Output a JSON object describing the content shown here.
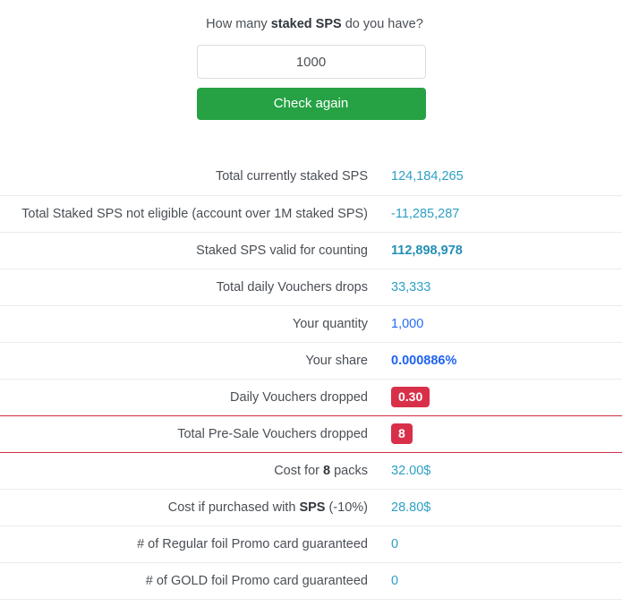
{
  "form": {
    "question_prefix": "How many ",
    "question_bold": "staked SPS",
    "question_suffix": " do you have?",
    "input_value": "1000",
    "input_placeholder": "",
    "button_label": "Check again",
    "button_color": "#26a244"
  },
  "colors": {
    "value_teal": "#2e9fc4",
    "value_blue": "#2a6cf4",
    "badge_red": "#d9304a",
    "highlight_border": "#cf2e43",
    "row_divider": "#e9ecef",
    "label_text": "#4a4f55"
  },
  "results": {
    "rows": [
      {
        "label": "Total currently staked SPS",
        "label_bold": "",
        "label_suffix": "",
        "value": "124,184,265",
        "style": "teal",
        "highlight": false
      },
      {
        "label": "Total Staked SPS not eligible (account over 1M staked SPS)",
        "label_bold": "",
        "label_suffix": "",
        "value": "-11,285,287",
        "style": "teal",
        "highlight": false
      },
      {
        "label": "Staked SPS valid for counting",
        "label_bold": "",
        "label_suffix": "",
        "value": "112,898,978",
        "style": "teal-bold",
        "highlight": false
      },
      {
        "label": "Total daily Vouchers drops",
        "label_bold": "",
        "label_suffix": "",
        "value": "33,333",
        "style": "teal",
        "highlight": false
      },
      {
        "label": "Your quantity",
        "label_bold": "",
        "label_suffix": "",
        "value": "1,000",
        "style": "blue",
        "highlight": false
      },
      {
        "label": "Your share",
        "label_bold": "",
        "label_suffix": "",
        "value": "0.000886%",
        "style": "blue-bold",
        "highlight": false
      },
      {
        "label": "Daily Vouchers dropped",
        "label_bold": "",
        "label_suffix": "",
        "value": "0.30",
        "style": "badge",
        "highlight": true
      },
      {
        "label": "Total Pre-Sale Vouchers dropped",
        "label_bold": "",
        "label_suffix": "",
        "value": "8",
        "style": "badge",
        "highlight": true
      },
      {
        "label": "Cost for ",
        "label_bold": "8",
        "label_suffix": " packs",
        "value": "32.00$",
        "style": "teal",
        "highlight": false
      },
      {
        "label": "Cost if purchased with ",
        "label_bold": "SPS",
        "label_suffix": " (-10%)",
        "value": "28.80$",
        "style": "teal",
        "highlight": false
      },
      {
        "label": "# of Regular foil Promo card guaranteed",
        "label_bold": "",
        "label_suffix": "",
        "value": "0",
        "style": "teal",
        "highlight": false
      },
      {
        "label": "# of GOLD foil Promo card guaranteed",
        "label_bold": "",
        "label_suffix": "",
        "value": "0",
        "style": "teal",
        "highlight": false
      }
    ]
  }
}
